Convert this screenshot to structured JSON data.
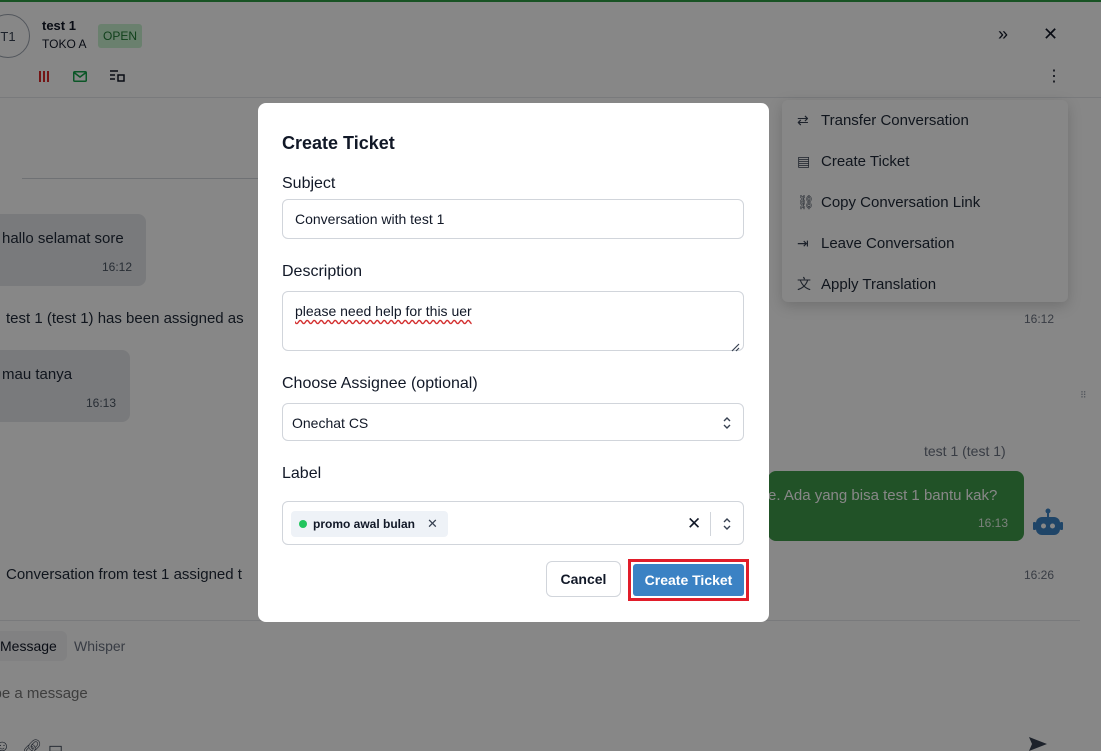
{
  "header": {
    "avatar_initials": "T1",
    "contact_name": "test 1",
    "contact_sub": "TOKO A",
    "status": "OPEN",
    "expand_icon": "chevrons-right-icon",
    "close_icon": "close-icon",
    "more_icon": "vertical-dots-icon"
  },
  "menu": {
    "items": [
      {
        "label": "Transfer Conversation",
        "icon": "transfer-icon"
      },
      {
        "label": "Create Ticket",
        "icon": "ticket-icon"
      },
      {
        "label": "Copy Conversation Link",
        "icon": "link-icon"
      },
      {
        "label": "Leave Conversation",
        "icon": "exit-icon"
      },
      {
        "label": "Apply Translation",
        "icon": "translate-icon"
      }
    ]
  },
  "timeline": {
    "msg1_text": "hallo selamat sore",
    "msg1_time": "16:12",
    "sys1_text": "test 1 (test 1) has been assigned as",
    "sys1_time": "16:12",
    "msg2_text": "mau tanya",
    "msg2_time": "16:13",
    "sender": "test 1 (test 1)",
    "reply_text": "e. Ada yang bisa test 1 bantu kak?",
    "reply_time": "16:13",
    "sys2_text": "Conversation from test 1 assigned t",
    "sys2_time": "16:26"
  },
  "composer": {
    "tab_message": "Message",
    "tab_whisper": "Whisper",
    "placeholder": "ype a message"
  },
  "modal": {
    "title": "Create Ticket",
    "subject_label": "Subject",
    "subject_value": "Conversation with test 1",
    "description_label": "Description",
    "description_value": "please need help for this uer",
    "assignee_label": "Choose Assignee (optional)",
    "assignee_value": "Onechat CS",
    "label_label": "Label",
    "label_chip": "promo awal bulan",
    "chip_color": "#22c55e",
    "cancel_label": "Cancel",
    "create_label": "Create Ticket",
    "create_color": "#3b82c4",
    "highlight_color": "#e11d2a"
  }
}
